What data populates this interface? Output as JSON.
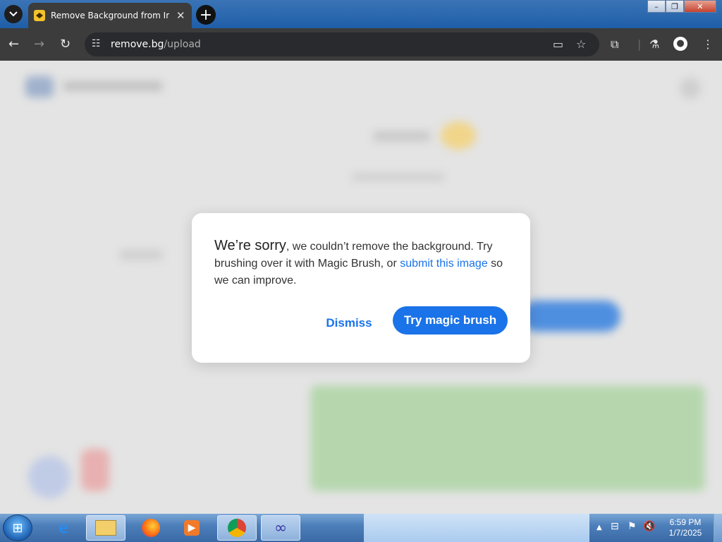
{
  "browser": {
    "tab_title": "Remove Background from Image",
    "url_host": "remove.bg",
    "url_path": "/upload",
    "new_tab_symbol": "+",
    "tab_close_symbol": "✕",
    "icons": [
      "tab-search-icon",
      "favicon",
      "back-icon",
      "forward-icon",
      "reload-icon",
      "site-settings-icon",
      "cast-icon",
      "bookmark-star-icon",
      "extensions-icon",
      "labs-icon",
      "profile-icon",
      "menu-icon"
    ]
  },
  "window_controls": {
    "minimize": "–",
    "maximize": "❐",
    "close": "✕"
  },
  "dialog": {
    "lead": "We’re sorry",
    "text1": ", we couldn’t remove the background. Try brushing over it with Magic Brush, or ",
    "link": "submit this image",
    "text2": " so we can improve.",
    "dismiss_label": "Dismiss",
    "primary_label": "Try magic brush",
    "accent_color": "#1a73e8"
  },
  "taskbar": {
    "time": "6:59 PM",
    "date": "1/7/2025",
    "icons": [
      "start-orb-icon",
      "internet-explorer-icon",
      "file-explorer-icon",
      "firefox-icon",
      "media-player-icon",
      "chrome-icon",
      "app-infinity-icon"
    ],
    "tray_icons": [
      "show-hidden-icon",
      "network-icon",
      "action-center-flag-icon",
      "volume-muted-icon"
    ]
  }
}
